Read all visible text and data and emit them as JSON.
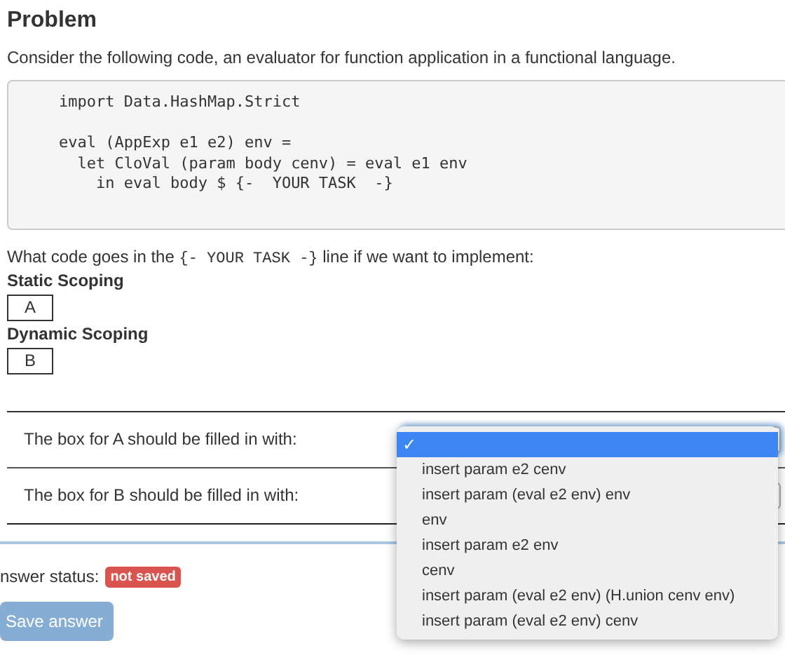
{
  "heading": "Problem",
  "intro": "Consider the following code, an evaluator for function application in a functional language.",
  "code_paragraphs": [
    [
      "import Data.HashMap.Strict"
    ],
    [
      "eval (AppExp e1 e2) env =",
      "  let CloVal (param body cenv) = eval e1 env",
      "    in eval body $ {-  YOUR TASK  -}"
    ]
  ],
  "question": {
    "before": "What code goes in the ",
    "code": "{- YOUR TASK -}",
    "after": " line if we want to implement:"
  },
  "blanks": [
    {
      "title": "Static Scoping",
      "box": "A"
    },
    {
      "title": "Dynamic Scoping",
      "box": "B"
    }
  ],
  "answers": [
    {
      "label": "The box for A should be filled in with:",
      "open": true
    },
    {
      "label": "The box for B should be filled in with:",
      "open": false
    }
  ],
  "menu_options": [
    {
      "mark": "✓",
      "selected": true
    },
    {
      "label": "insert param e2 cenv",
      "selected": false
    },
    {
      "label": "insert param (eval e2 env) env",
      "selected": false
    },
    {
      "label": "env",
      "selected": false
    },
    {
      "label": "insert param e2 env",
      "selected": false
    },
    {
      "label": "cenv",
      "selected": false
    },
    {
      "label": "insert param (eval e2 env) (H.union cenv env)",
      "selected": false
    },
    {
      "label": "insert param (eval e2 env) cenv",
      "selected": false
    }
  ],
  "status": {
    "label": "nswer status:",
    "badge": "not saved"
  },
  "save_button": {
    "label": "Save answer",
    "disabled": true
  }
}
